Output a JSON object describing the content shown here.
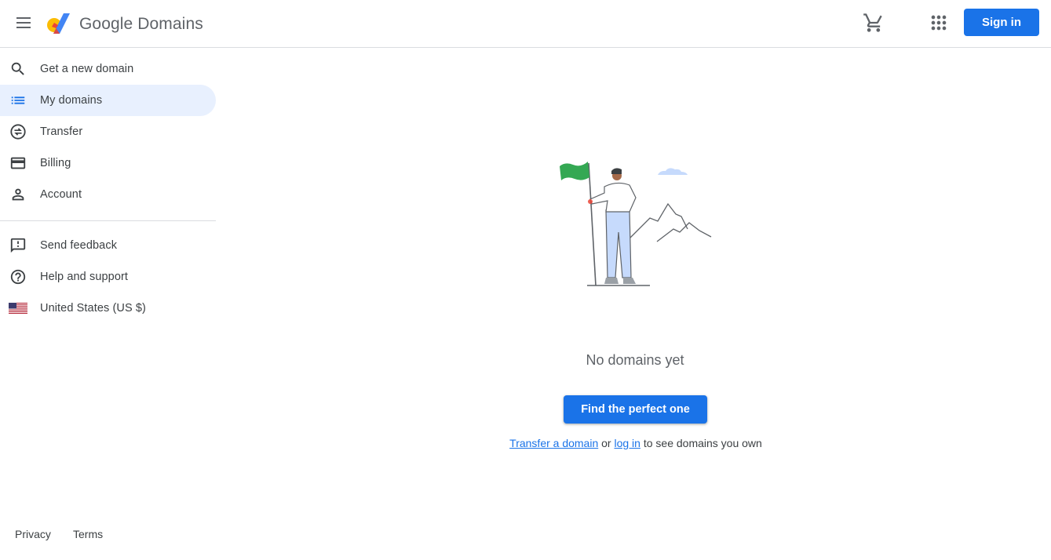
{
  "header": {
    "brand_google": "Google",
    "brand_product": "Domains",
    "menu_icon": "menu-icon",
    "cart_icon": "shopping-cart-icon",
    "apps_icon": "apps-grid-icon",
    "sign_in_label": "Sign in"
  },
  "sidebar": {
    "items": [
      {
        "label": "Get a new domain",
        "icon": "search-icon"
      },
      {
        "label": "My domains",
        "icon": "list-icon",
        "active": true
      },
      {
        "label": "Transfer",
        "icon": "transfer-icon"
      },
      {
        "label": "Billing",
        "icon": "credit-card-icon"
      },
      {
        "label": "Account",
        "icon": "person-icon"
      }
    ],
    "secondary": [
      {
        "label": "Send feedback",
        "icon": "feedback-icon"
      },
      {
        "label": "Help and support",
        "icon": "help-icon"
      },
      {
        "label": "United States (US $)",
        "icon": "us-flag-icon"
      }
    ],
    "footer": {
      "privacy": "Privacy",
      "terms": "Terms"
    }
  },
  "main": {
    "empty_title": "No domains yet",
    "cta_label": "Find the perfect one",
    "transfer_link": "Transfer a domain",
    "or_text": " or ",
    "login_link": "log in",
    "suffix_text": " to see domains you own"
  },
  "colors": {
    "accent": "#1a73e8",
    "active_bg": "#e8f0fe",
    "flag_green": "#34a853"
  }
}
